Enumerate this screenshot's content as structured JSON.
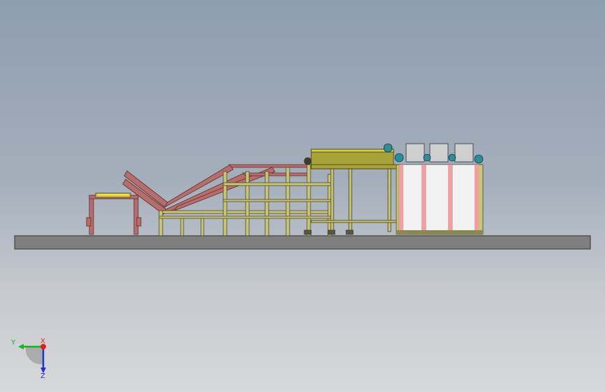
{
  "scene": {
    "description_colors": {
      "background_top": "#8e9db0",
      "background_bottom": "#d7d8da",
      "floor": "#7f7f7f",
      "frame_yellow": "#c9c57a",
      "frame_red": "#b76d6b",
      "conveyor_olive": "#a9a23a",
      "motor_teal": "#2b8f95",
      "bag_white": "#f2f2f2",
      "bag_pink": "#f0a0a0"
    }
  },
  "triad": {
    "x_label": "X",
    "y_label": "Y",
    "z_label": "Z",
    "x_color": "#e02020",
    "y_color": "#20b020",
    "z_color": "#2030d0"
  }
}
